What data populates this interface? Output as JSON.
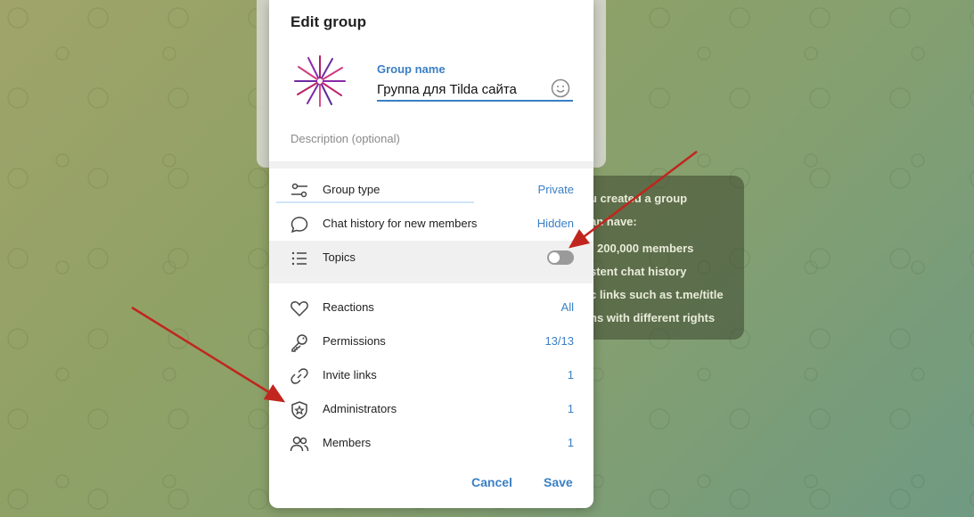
{
  "background": {
    "info_lines": [
      "u created a group",
      "an have:",
      "200,000 members",
      "stent chat history",
      "c links such as t.me/title",
      "ns with different rights"
    ]
  },
  "dialog": {
    "title": "Edit group",
    "group_name_label": "Group name",
    "group_name_value": "Группа для Tilda сайта",
    "description_placeholder": "Description (optional)",
    "settings": [
      {
        "label": "Group type",
        "value": "Private",
        "icon": "sliders-icon"
      },
      {
        "label": "Chat history for new members",
        "value": "Hidden",
        "icon": "chat-bubble-icon"
      },
      {
        "label": "Topics",
        "value": "",
        "icon": "list-icon",
        "toggle": false
      }
    ],
    "manage": [
      {
        "label": "Reactions",
        "value": "All",
        "icon": "heart-icon"
      },
      {
        "label": "Permissions",
        "value": "13/13",
        "icon": "key-icon"
      },
      {
        "label": "Invite links",
        "value": "1",
        "icon": "link-icon"
      },
      {
        "label": "Administrators",
        "value": "1",
        "icon": "shield-star-icon"
      },
      {
        "label": "Members",
        "value": "1",
        "icon": "members-icon"
      }
    ],
    "cancel_label": "Cancel",
    "save_label": "Save"
  },
  "colors": {
    "accent": "#3a7fc4",
    "annotation_arrow": "#c0261e"
  }
}
